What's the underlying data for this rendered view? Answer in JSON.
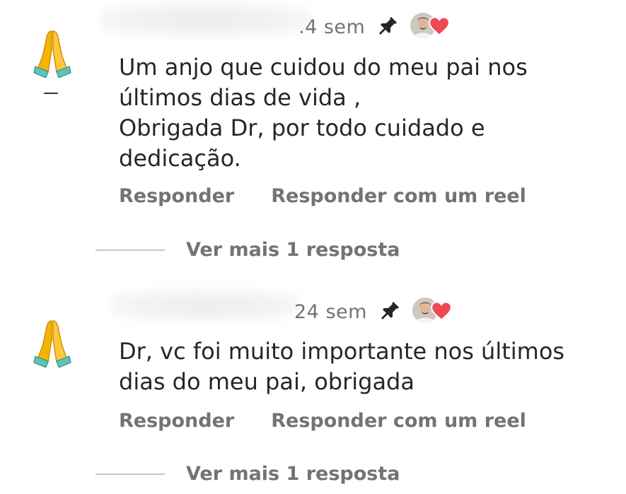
{
  "comments": [
    {
      "time": ".4 sem",
      "text": "Um anjo que cuidou do meu pai nos\núltimos dias de vida ,\nObrigada Dr, por todo cuidado e\ndedicação.",
      "reply_label": "Responder",
      "reel_label": "Responder com um reel",
      "more_replies": "Ver mais 1 resposta",
      "avatar_icon": "folded-hands-emoji",
      "liked_by_author": true
    },
    {
      "time": "24 sem",
      "text": "Dr, vc foi muito importante nos últimos\ndias do meu pai, obrigada",
      "reply_label": "Responder",
      "reel_label": "Responder com um reel",
      "more_replies": "Ver mais 1 resposta",
      "avatar_icon": "folded-hands-emoji",
      "liked_by_author": true
    }
  ],
  "colors": {
    "text": "#262626",
    "secondary": "#737373",
    "heart": "#ed4956",
    "divider": "#c7c7c7"
  },
  "icons": [
    "pin-icon",
    "heart-icon",
    "folded-hands-emoji",
    "author-avatar"
  ]
}
